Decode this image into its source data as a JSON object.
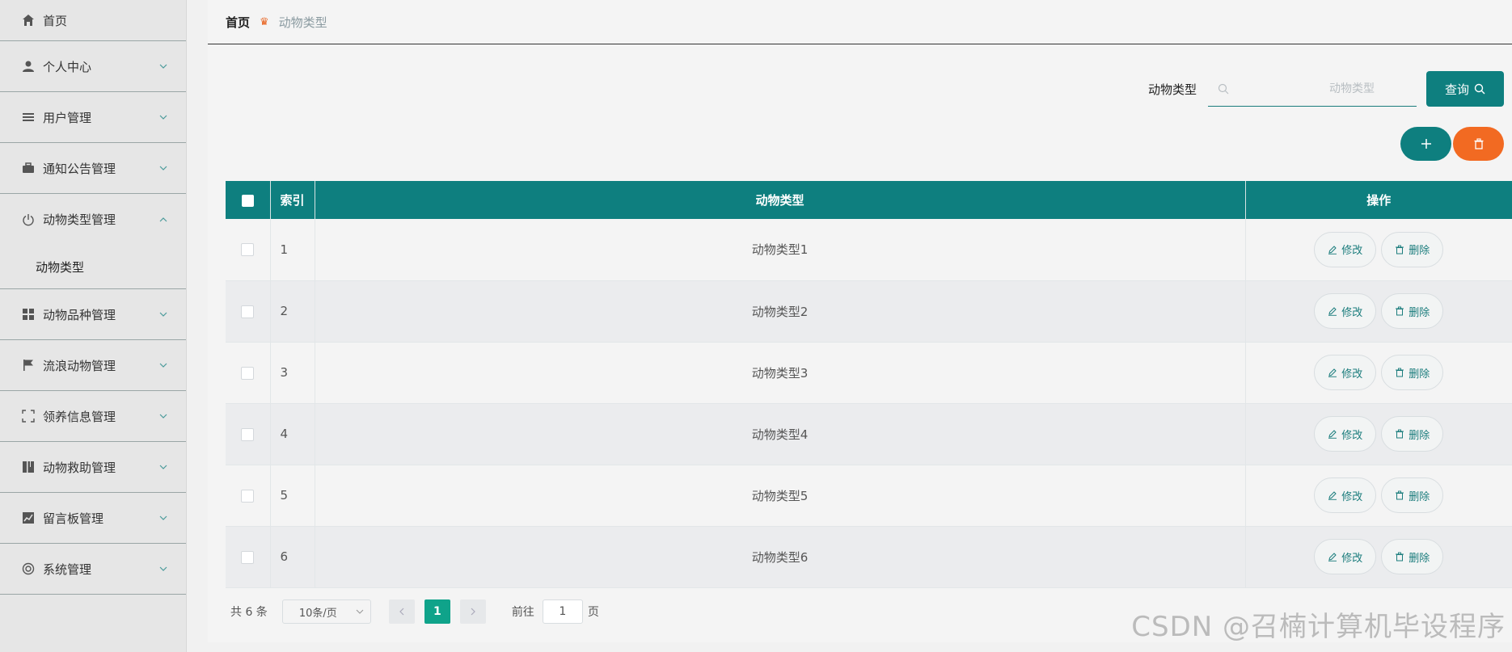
{
  "sidebar": {
    "items": [
      {
        "label": "首页",
        "icon": "home-icon"
      },
      {
        "label": "个人中心",
        "icon": "user-icon"
      },
      {
        "label": "用户管理",
        "icon": "list-icon"
      },
      {
        "label": "通知公告管理",
        "icon": "briefcase-icon"
      },
      {
        "label": "动物类型管理",
        "icon": "power-icon"
      },
      {
        "label": "动物品种管理",
        "icon": "grid-icon"
      },
      {
        "label": "流浪动物管理",
        "icon": "flag-icon"
      },
      {
        "label": "领养信息管理",
        "icon": "scan-icon"
      },
      {
        "label": "动物救助管理",
        "icon": "book-icon"
      },
      {
        "label": "留言板管理",
        "icon": "chart-icon"
      },
      {
        "label": "系统管理",
        "icon": "lifebuoy-icon"
      }
    ],
    "submenu_label": "动物类型"
  },
  "breadcrumb": {
    "home": "首页",
    "current": "动物类型"
  },
  "search": {
    "label": "动物类型",
    "placeholder": "动物类型",
    "button": "查询"
  },
  "table": {
    "headers": {
      "index": "索引",
      "name": "动物类型",
      "ops": "操作"
    },
    "rows": [
      {
        "index": "1",
        "name": "动物类型1"
      },
      {
        "index": "2",
        "name": "动物类型2"
      },
      {
        "index": "3",
        "name": "动物类型3"
      },
      {
        "index": "4",
        "name": "动物类型4"
      },
      {
        "index": "5",
        "name": "动物类型5"
      },
      {
        "index": "6",
        "name": "动物类型6"
      }
    ],
    "edit_label": "修改",
    "delete_label": "删除"
  },
  "pager": {
    "total": "共 6 条",
    "page_size": "10条/页",
    "current_page": "1",
    "goto_label": "前往",
    "goto_value": "1",
    "page_unit": "页"
  },
  "watermark": "CSDN @召楠计算机毕设程序",
  "colors": {
    "primary": "#0e7f7f",
    "danger": "#f26a22",
    "pager_active": "#0fa38a"
  }
}
